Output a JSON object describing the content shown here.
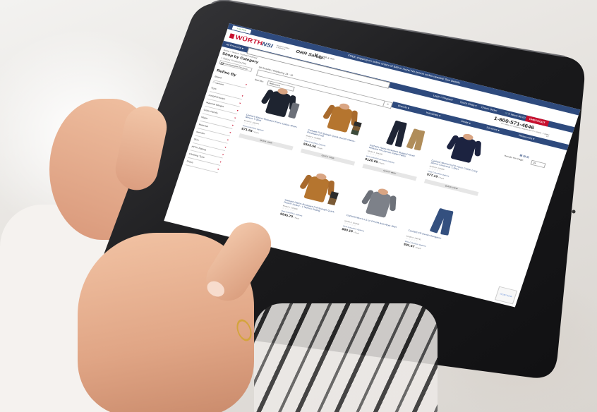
{
  "site": {
    "promo": "FREE shipping on online orders of $49 or more! No promo codes needed! See Details",
    "live_help": "Live Help",
    "logos": {
      "wurth": "WÜRTH",
      "nsi": "NSI",
      "nsi_sub": "Northern Safety & Industrial",
      "orr": "ORR Safety",
      "vh": "OLIVER & VAN HORN"
    },
    "nav": {
      "all_products": "All Products ▾",
      "login": "Login / Register",
      "quick_shop": "Quick Shop ▾",
      "check_order": "Check Order",
      "cart": "0 Items $0.00",
      "checkout": "CHECKOUT"
    },
    "breadcrumb": "Home > Search \"Carhartt clothing\"",
    "shop_by_category": "Shop by Category",
    "category_sub": "> Safety Products (58)",
    "show_available": "Show Available Products",
    "results_text": "58 Results | Displaying 13 - 16",
    "phone": "1-800-571-4646",
    "phone_sub": "For Sales and Customer Support Mon-Fri 7:00AM - 7:00PM ET",
    "menu": [
      "Brands ▾",
      "Industries ▾",
      "Deals ▾",
      "Services ▾",
      "Resources ▾"
    ],
    "refine_by": "Refine By",
    "facets": [
      "Brand",
      "Type",
      "Length/Inseam",
      "Material Weight",
      "Color Family",
      "Waist",
      "Material",
      "Gender",
      "Size",
      "ATPV Rating",
      "Clothing Type",
      "Class"
    ],
    "brand_option": "☐ Carhartt",
    "sort_by": "Sort By:",
    "sort_value": "Relevance",
    "results_per_page": "Results Per Page:",
    "results_per_page_value": "24",
    "recaptcha": "reCAPTCHA"
  },
  "products": [
    {
      "title": "Carhartt Flame-Resistant Force Cotton Short-Sleeve T-Shirt",
      "model": "Model #: 100234",
      "stars": "☆☆☆☆☆",
      "options": "View Color/Size Options",
      "price": "$71.93",
      "unit": "/ Each",
      "quick_view": "QUICK VIEW"
    },
    {
      "title": "Carhartt Full Swing® Quick Duck® Flame-Resistant Coat",
      "model": "Model #: 101689",
      "stars": "☆☆☆☆☆",
      "options": "View Color/Size Options",
      "price": "$313.56",
      "unit": "/ Each",
      "quick_view": "QUICK VIEW"
    },
    {
      "title": "Carhartt Flame-Resistant Rugged Flex® Relaxed Fit Canvas Cargo Pants",
      "model": "Model #: 104205",
      "stars": "☆☆☆☆☆",
      "options": "View Color/Size/Inseam Options",
      "price": "$120.65",
      "unit": "/ Each",
      "quick_view": "QUICK VIEW"
    },
    {
      "title": "Carhartt Women's FR Force Cotton Long Sleeve Crewneck T-Shirt",
      "model": "Model #: 102095",
      "stars": "☆☆☆☆☆",
      "options": "View Color/Size Options",
      "price": "$77.19",
      "unit": "/ Each",
      "quick_view": "QUICK VIEW"
    },
    {
      "title": "Carhartt Flame-Resistant Full Swing® Quick Duck® Jacket - 1 Nomex Rating",
      "model": "Model #: 101688",
      "stars": "☆☆☆☆☆",
      "options": "View Color/Size Options",
      "price": "$245.70",
      "unit": "/ Each",
      "quick_view": "QUICK VIEW"
    },
    {
      "title": "Carhartt Men's 6.5 oz FR DH Anti-Work Shirt",
      "model": "Model #: 100235",
      "stars": "☆☆☆☆☆",
      "options": "View Color/Size Options",
      "price": "$80.19",
      "unit": "/ Each",
      "quick_view": "QUICK VIEW"
    },
    {
      "title": "Carhartt FR Denim Dungaree",
      "model": "Model #: 100791",
      "stars": "☆☆☆☆☆",
      "options": "View Color/Size Options",
      "price": "$91.67",
      "unit": "/ Each",
      "quick_view": "QUICK VIEW"
    }
  ],
  "colors": {
    "brand_red": "#c8102e",
    "brand_navy": "#2e4a7d",
    "tablet_bezel": "#1b1b1d"
  }
}
